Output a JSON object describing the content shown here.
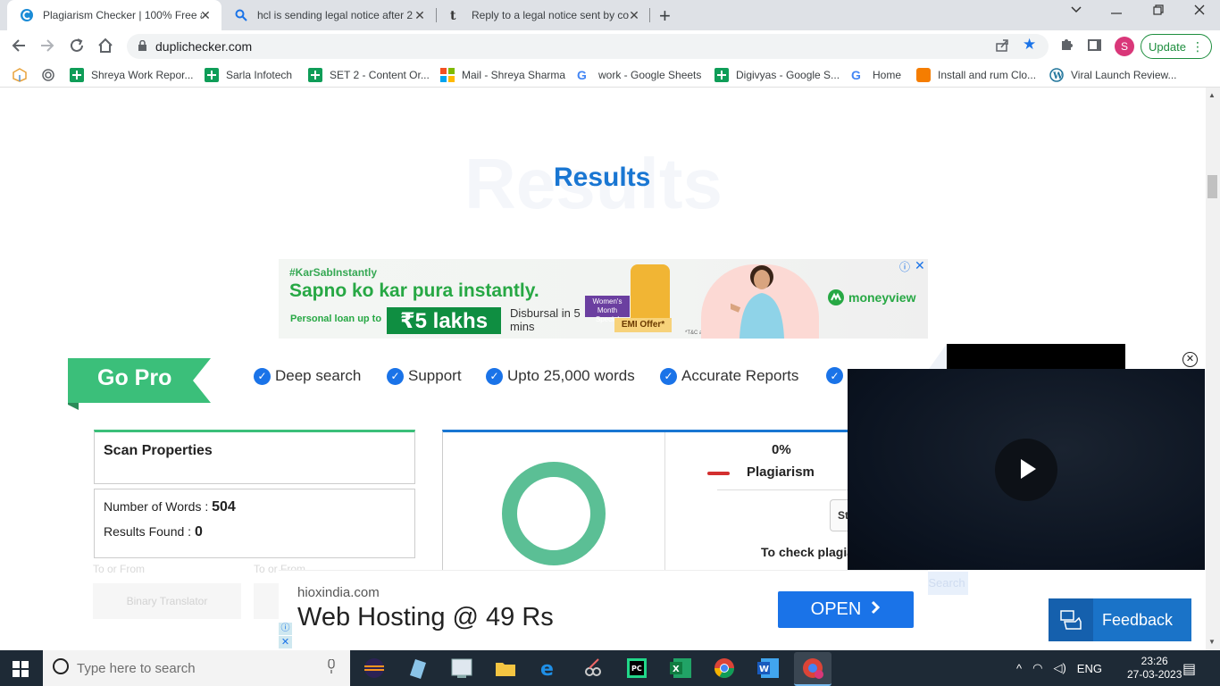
{
  "browser": {
    "tabs": [
      {
        "title": "Plagiarism Checker | 100% Free a",
        "active": true
      },
      {
        "title": "hcl is sending legal notice after 2",
        "active": false
      },
      {
        "title": "Reply to a legal notice sent by co",
        "active": false
      }
    ],
    "new_tab": "+",
    "close": "✕",
    "url": "duplichecker.com",
    "profile_initial": "S",
    "update_label": "Update",
    "bookmarks": [
      {
        "label": "Shreya Work Repor...",
        "icon": "sheets-icon"
      },
      {
        "label": "Sarla Infotech",
        "icon": "sheets-icon"
      },
      {
        "label": "SET 2 - Content Or...",
        "icon": "sheets-icon"
      },
      {
        "label": "Mail - Shreya Sharma",
        "icon": "microsoft-icon"
      },
      {
        "label": "work - Google Sheets",
        "icon": "google-icon"
      },
      {
        "label": "Digivyas - Google S...",
        "icon": "sheets-icon"
      },
      {
        "label": "Home",
        "icon": "google-icon"
      },
      {
        "label": "Install and rum Clo...",
        "icon": "blogger-icon"
      },
      {
        "label": "Viral Launch Review...",
        "icon": "wordpress-icon"
      }
    ]
  },
  "page": {
    "ghost_heading": "Results",
    "heading": "Results",
    "top_ad": {
      "tag": "#KarSabInstantly",
      "headline": "Sapno ko kar pura instantly.",
      "sub": "Personal loan up to",
      "amount": "₹5 lakhs",
      "disbursal": "Disbursal in 5 mins",
      "badge": "Women's Month Special",
      "emi": "EMI Offer*",
      "tc": "*T&C apply.",
      "brand": "moneyview"
    },
    "gopro": {
      "label": "Go Pro",
      "features": [
        "Deep search",
        "Support",
        "Upto 25,000 words",
        "Accurate Reports"
      ]
    },
    "scan": {
      "title": "Scan Properties",
      "words_label": "Number of Words : ",
      "words_value": "504",
      "results_label": "Results Found : ",
      "results_value": "0"
    },
    "faded": {
      "left_label": "To or From",
      "right_label": "To or From",
      "button": "Binary Translator",
      "search": "Search"
    },
    "result": {
      "percent": "0%",
      "percent_value": 0,
      "plagiarism_label": "Plagiarism",
      "button_partial": "St",
      "to_check": "To check plagiarism"
    },
    "bottom_ad": {
      "site": "hioxindia.com",
      "headline": "Web Hosting @ 49 Rs",
      "cta": "OPEN"
    },
    "feedback": "Feedback"
  },
  "taskbar": {
    "search_placeholder": "Type here to search",
    "lang": "ENG",
    "time": "23:26",
    "date": "27-03-2023"
  }
}
